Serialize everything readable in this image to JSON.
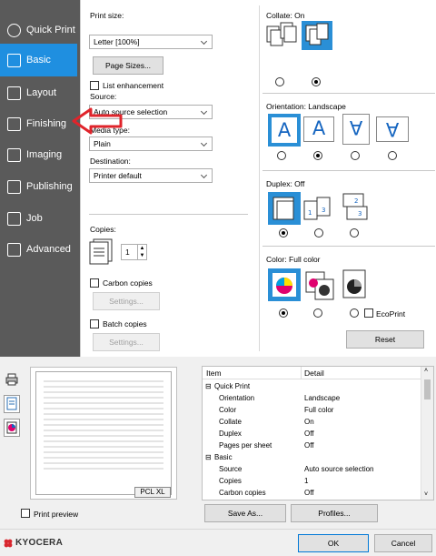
{
  "sidebar": {
    "items": [
      {
        "label": "Quick Print",
        "icon": "clock-icon"
      },
      {
        "label": "Basic",
        "icon": "document-icon"
      },
      {
        "label": "Layout",
        "icon": "grid-icon"
      },
      {
        "label": "Finishing",
        "icon": "stapled-pages-icon"
      },
      {
        "label": "Imaging",
        "icon": "image-icon"
      },
      {
        "label": "Publishing",
        "icon": "book-icon"
      },
      {
        "label": "Job",
        "icon": "job-icon"
      },
      {
        "label": "Advanced",
        "icon": "advanced-icon"
      }
    ],
    "selected": "Basic"
  },
  "basic": {
    "print_size_label": "Print size:",
    "print_size_value": "Letter  [100%]",
    "page_sizes_button": "Page Sizes...",
    "list_enhancement_label": "List enhancement",
    "source_label": "Source:",
    "source_value": "Auto source selection",
    "media_type_label": "Media type:",
    "media_type_value": "Plain",
    "destination_label": "Destination:",
    "destination_value": "Printer default",
    "copies_label": "Copies:",
    "copies_value": "1",
    "carbon_copies_label": "Carbon copies",
    "settings_button_1": "Settings...",
    "batch_copies_label": "Batch copies",
    "settings_button_2": "Settings...",
    "collate_label": "Collate:  On",
    "orientation_label": "Orientation:  Landscape",
    "duplex_label": "Duplex:  Off",
    "color_label": "Color:  Full color",
    "ecoprint_label": "EcoPrint",
    "reset_button": "Reset"
  },
  "side_tools": [
    "printer-icon",
    "document-icon",
    "color-icon"
  ],
  "preview": {
    "badge": "PCL XL"
  },
  "detail_table": {
    "headers": [
      "Item",
      "Detail"
    ],
    "rows": [
      {
        "item": "Quick Print",
        "detail": "",
        "group": true
      },
      {
        "item": "Orientation",
        "detail": "Landscape"
      },
      {
        "item": "Color",
        "detail": "Full color"
      },
      {
        "item": "Collate",
        "detail": "On"
      },
      {
        "item": "Duplex",
        "detail": "Off"
      },
      {
        "item": "Pages per sheet",
        "detail": "Off"
      },
      {
        "item": "Basic",
        "detail": "",
        "group": true
      },
      {
        "item": "Source",
        "detail": "Auto source selection"
      },
      {
        "item": "Copies",
        "detail": "1"
      },
      {
        "item": "Carbon copies",
        "detail": "Off"
      }
    ]
  },
  "footer": {
    "print_preview_label": "Print preview",
    "save_as_button": "Save As...",
    "profiles_button": "Profiles...",
    "brand": "KYOCERA",
    "ok_button": "OK",
    "cancel_button": "Cancel"
  },
  "colors": {
    "accent": "#1f8fe0",
    "sidebar": "#5a5a5a",
    "brand_red": "#d8262e",
    "arrow": "#e0242b"
  }
}
